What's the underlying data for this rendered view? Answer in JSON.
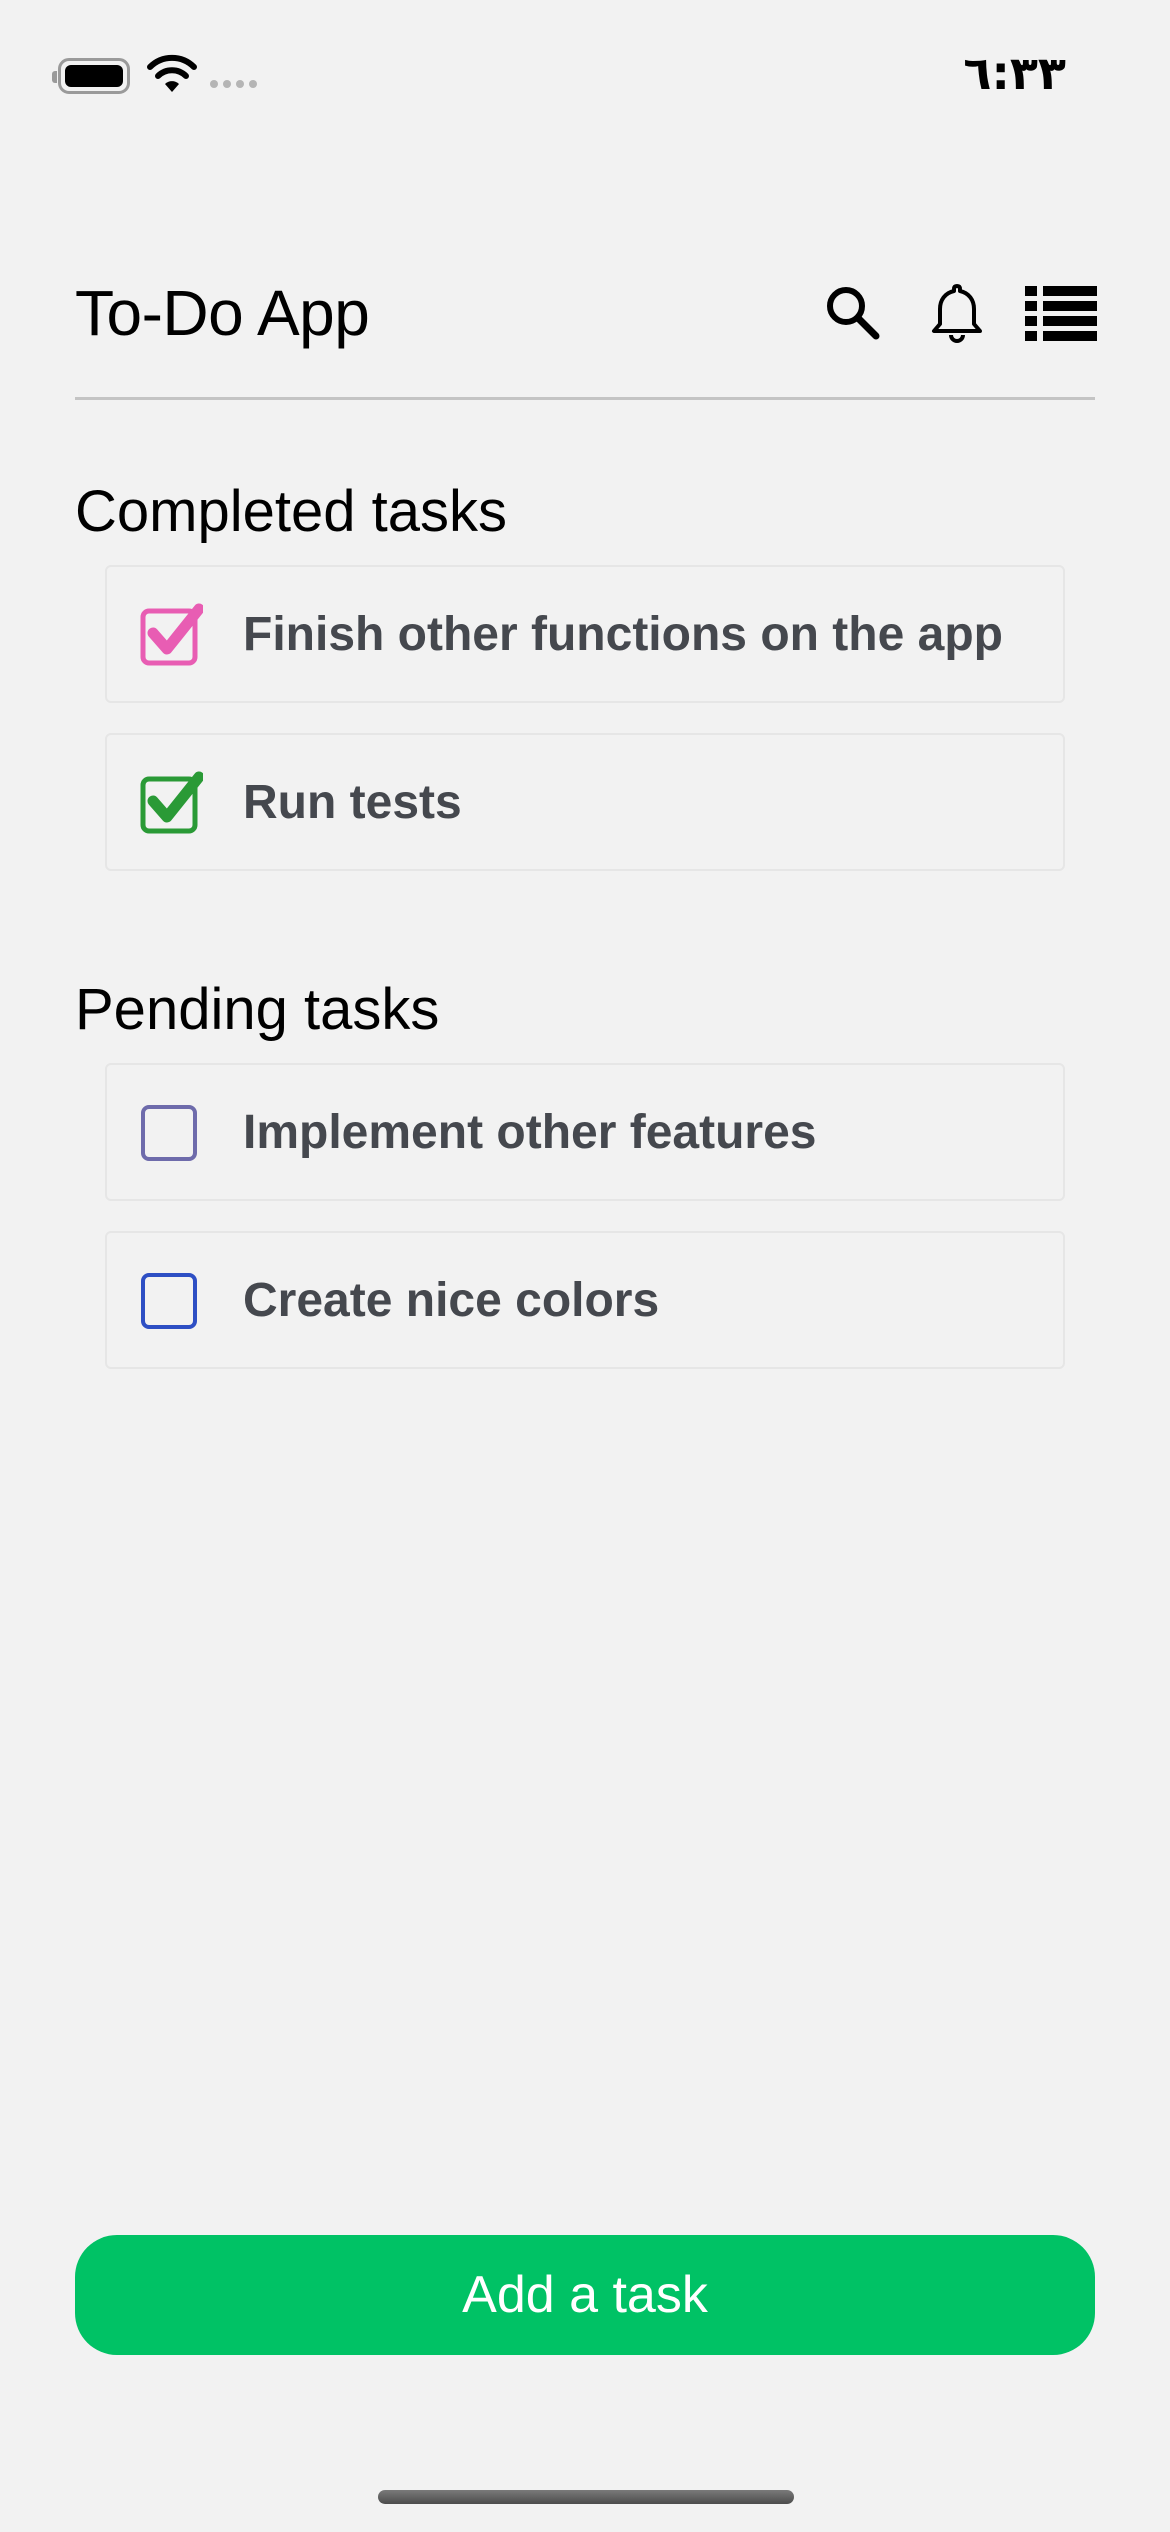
{
  "status_bar": {
    "time": "٦:٣٣",
    "battery_icon": "battery-full-icon",
    "wifi_icon": "wifi-icon",
    "signal_icon": "signal-dots-icon"
  },
  "header": {
    "title": "To-Do App",
    "icons": [
      "search-icon",
      "bell-icon",
      "list-icon"
    ]
  },
  "completed_section": {
    "title": "Completed tasks",
    "tasks": [
      {
        "label": "Finish other functions on the app",
        "checked": true,
        "color": "#e85db3"
      },
      {
        "label": "Run tests",
        "checked": true,
        "color": "#2a9a36"
      }
    ]
  },
  "pending_section": {
    "title": "Pending tasks",
    "tasks": [
      {
        "label": "Implement other features",
        "checked": false,
        "color": "#6e6bab"
      },
      {
        "label": "Create nice colors",
        "checked": false,
        "color": "#2e4fc4"
      }
    ]
  },
  "add_button": {
    "label": "Add a task",
    "color": "#00c265"
  },
  "colors": {
    "background": "#f2f2f2",
    "task_text": "#45484e",
    "divider": "#c4c4c4"
  }
}
